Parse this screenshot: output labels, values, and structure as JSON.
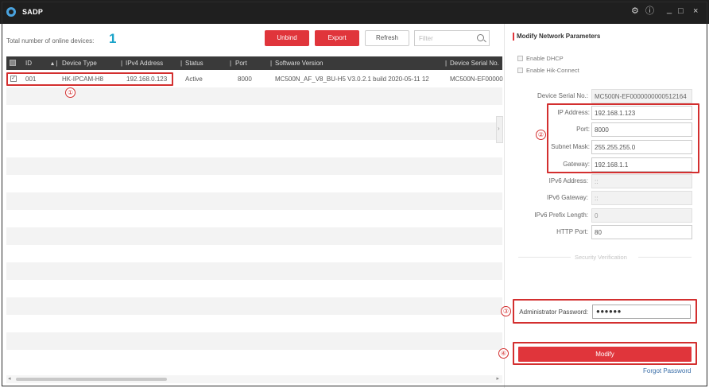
{
  "window": {
    "title": "SADP",
    "controls": [
      "⚙",
      "ⓘ",
      "_",
      "□",
      "×"
    ]
  },
  "toolbar": {
    "total_label": "Total number of online devices:",
    "total_count": "1",
    "unbind_label": "Unbind",
    "export_label": "Export",
    "refresh_label": "Refresh",
    "filter_placeholder": "Filter"
  },
  "table": {
    "columns": [
      "ID",
      "Device Type",
      "IPv4 Address",
      "Status",
      "Port",
      "Software Version",
      "Device Serial No."
    ],
    "rows": [
      {
        "id": "001",
        "device_type": "HK-IPCAM-H8",
        "ipv4": "192.168.0.123",
        "status": "Active",
        "port": "8000",
        "software": "MC500N_AF_V8_BU-H5 V3.0.2.1 build 2020-05-11 12",
        "serial": "MC500N-EF00000"
      }
    ]
  },
  "panel": {
    "title": "Modify Network Parameters",
    "enable_dhcp": "Enable DHCP",
    "enable_hik": "Enable Hik-Connect",
    "fields": {
      "serial_label": "Device Serial No.:",
      "serial_value": "MC500N-EF0000000000512164",
      "ip_label": "IP Address:",
      "ip_value": "192.168.1.123",
      "port_label": "Port:",
      "port_value": "8000",
      "mask_label": "Subnet Mask:",
      "mask_value": "255.255.255.0",
      "gateway_label": "Gateway:",
      "gateway_value": "192.168.1.1",
      "ipv6_label": "IPv6 Address:",
      "ipv6_value": "::",
      "ipv6_gw_label": "IPv6 Gateway:",
      "ipv6_gw_value": "::",
      "ipv6_prefix_label": "IPv6 Prefix Length:",
      "ipv6_prefix_value": "0",
      "http_label": "HTTP Port:",
      "http_value": "80"
    },
    "security_label": "Security Verification",
    "admin_pwd_label": "Administrator Password:",
    "admin_pwd_value": "●●●●●●",
    "modify_label": "Modify",
    "forgot_label": "Forgot Password"
  },
  "annotations": {
    "marker_1": "①",
    "marker_2": "②",
    "marker_3": "③",
    "marker_4": "④",
    "color": "#d32f2f"
  }
}
